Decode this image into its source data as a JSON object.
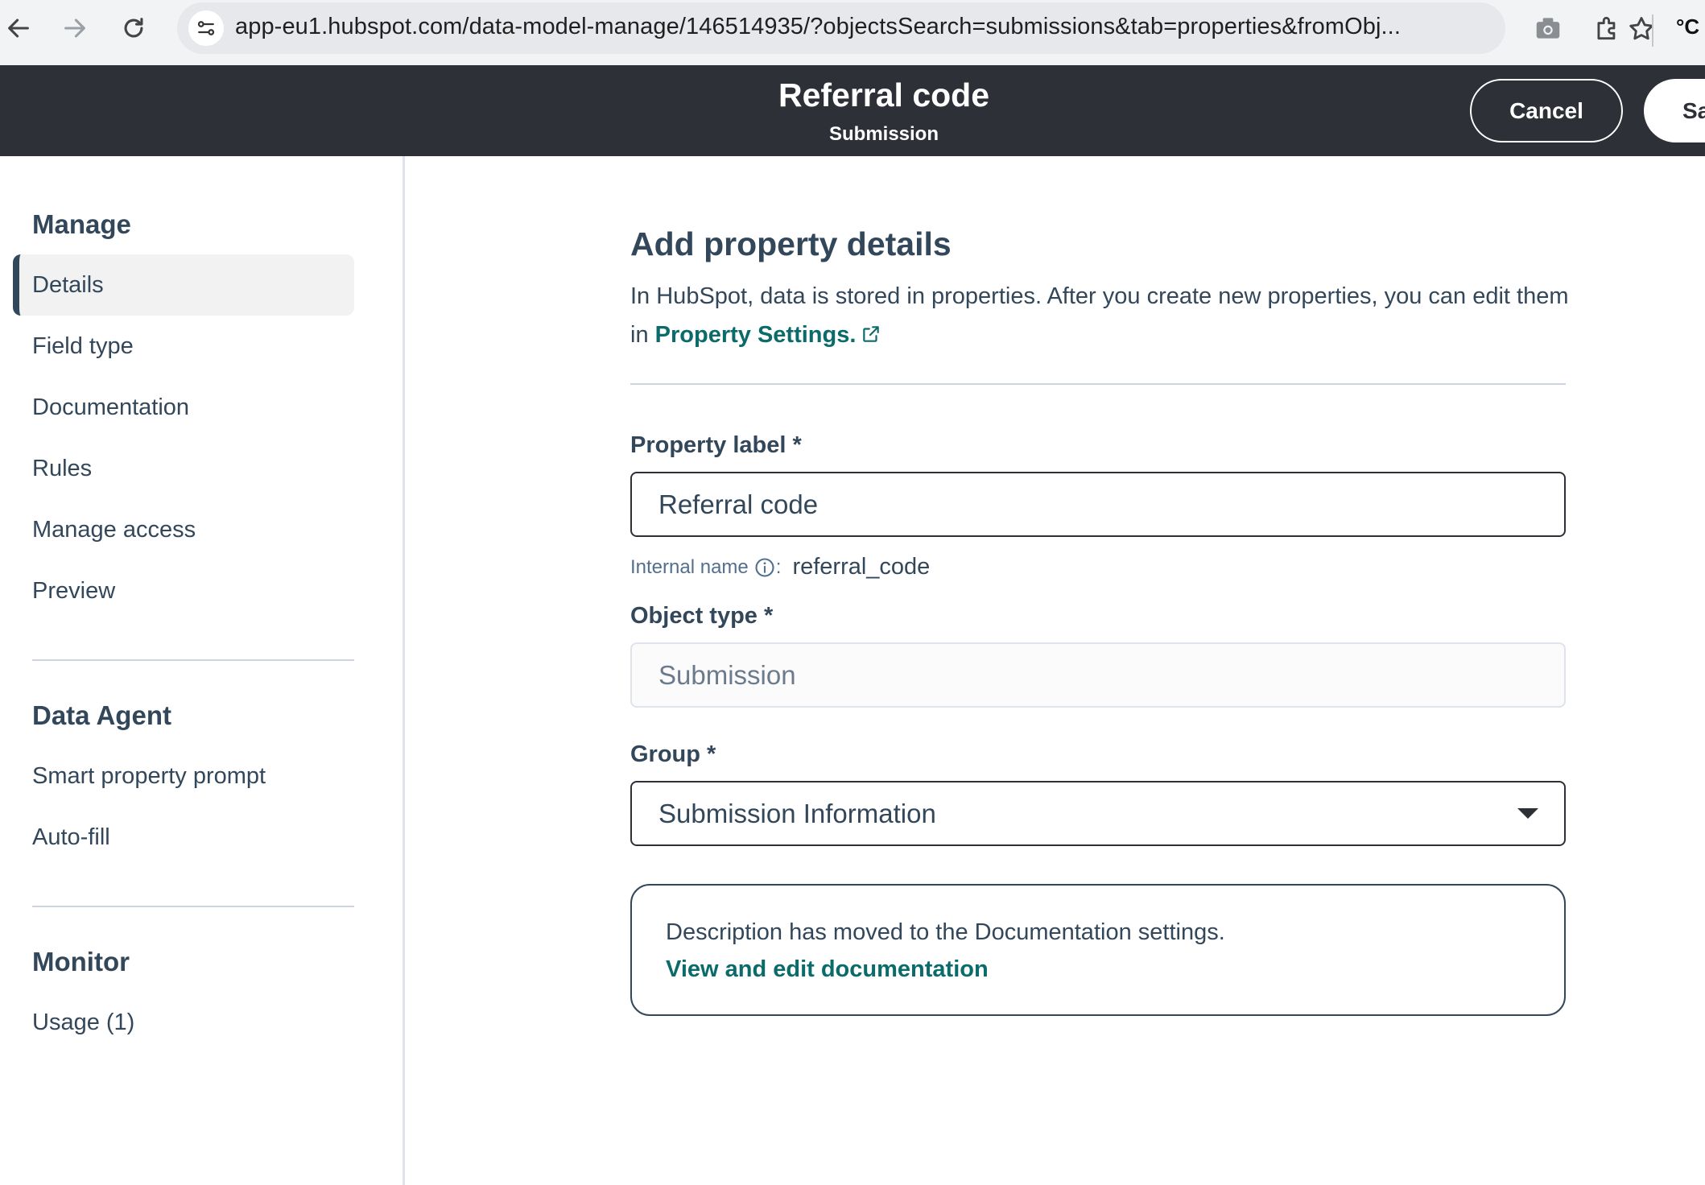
{
  "browser": {
    "url": "app-eu1.hubspot.com/data-model-manage/146514935/?objectsSearch=submissions&tab=properties&fromObj...",
    "extension_badge": "°C"
  },
  "header": {
    "title": "Referral code",
    "subtitle": "Submission",
    "cancel_label": "Cancel",
    "save_label": "Sa"
  },
  "sidebar": {
    "manage": {
      "title": "Manage",
      "items": [
        {
          "label": "Details",
          "active": true
        },
        {
          "label": "Field type"
        },
        {
          "label": "Documentation"
        },
        {
          "label": "Rules"
        },
        {
          "label": "Manage access"
        },
        {
          "label": "Preview"
        }
      ]
    },
    "data_agent": {
      "title": "Data Agent",
      "items": [
        {
          "label": "Smart property prompt"
        },
        {
          "label": "Auto-fill"
        }
      ]
    },
    "monitor": {
      "title": "Monitor",
      "items": [
        {
          "label": "Usage (1)"
        }
      ]
    }
  },
  "main": {
    "title": "Add property details",
    "intro_text": "In HubSpot, data is stored in properties. After you create new properties, you can edit them in ",
    "intro_link": "Property Settings.",
    "property_label": {
      "label": "Property label *",
      "value": "Referral code"
    },
    "internal_name": {
      "label": "Internal name",
      "separator": ":",
      "value": "referral_code"
    },
    "object_type": {
      "label": "Object type *",
      "value": "Submission"
    },
    "group": {
      "label": "Group *",
      "value": "Submission Information"
    },
    "notice": {
      "text": "Description has moved to the Documentation settings.",
      "link": "View and edit documentation"
    }
  },
  "colors": {
    "header_bg": "#2d3037",
    "link_teal": "#0b6b6b",
    "text_primary": "#33475b"
  }
}
